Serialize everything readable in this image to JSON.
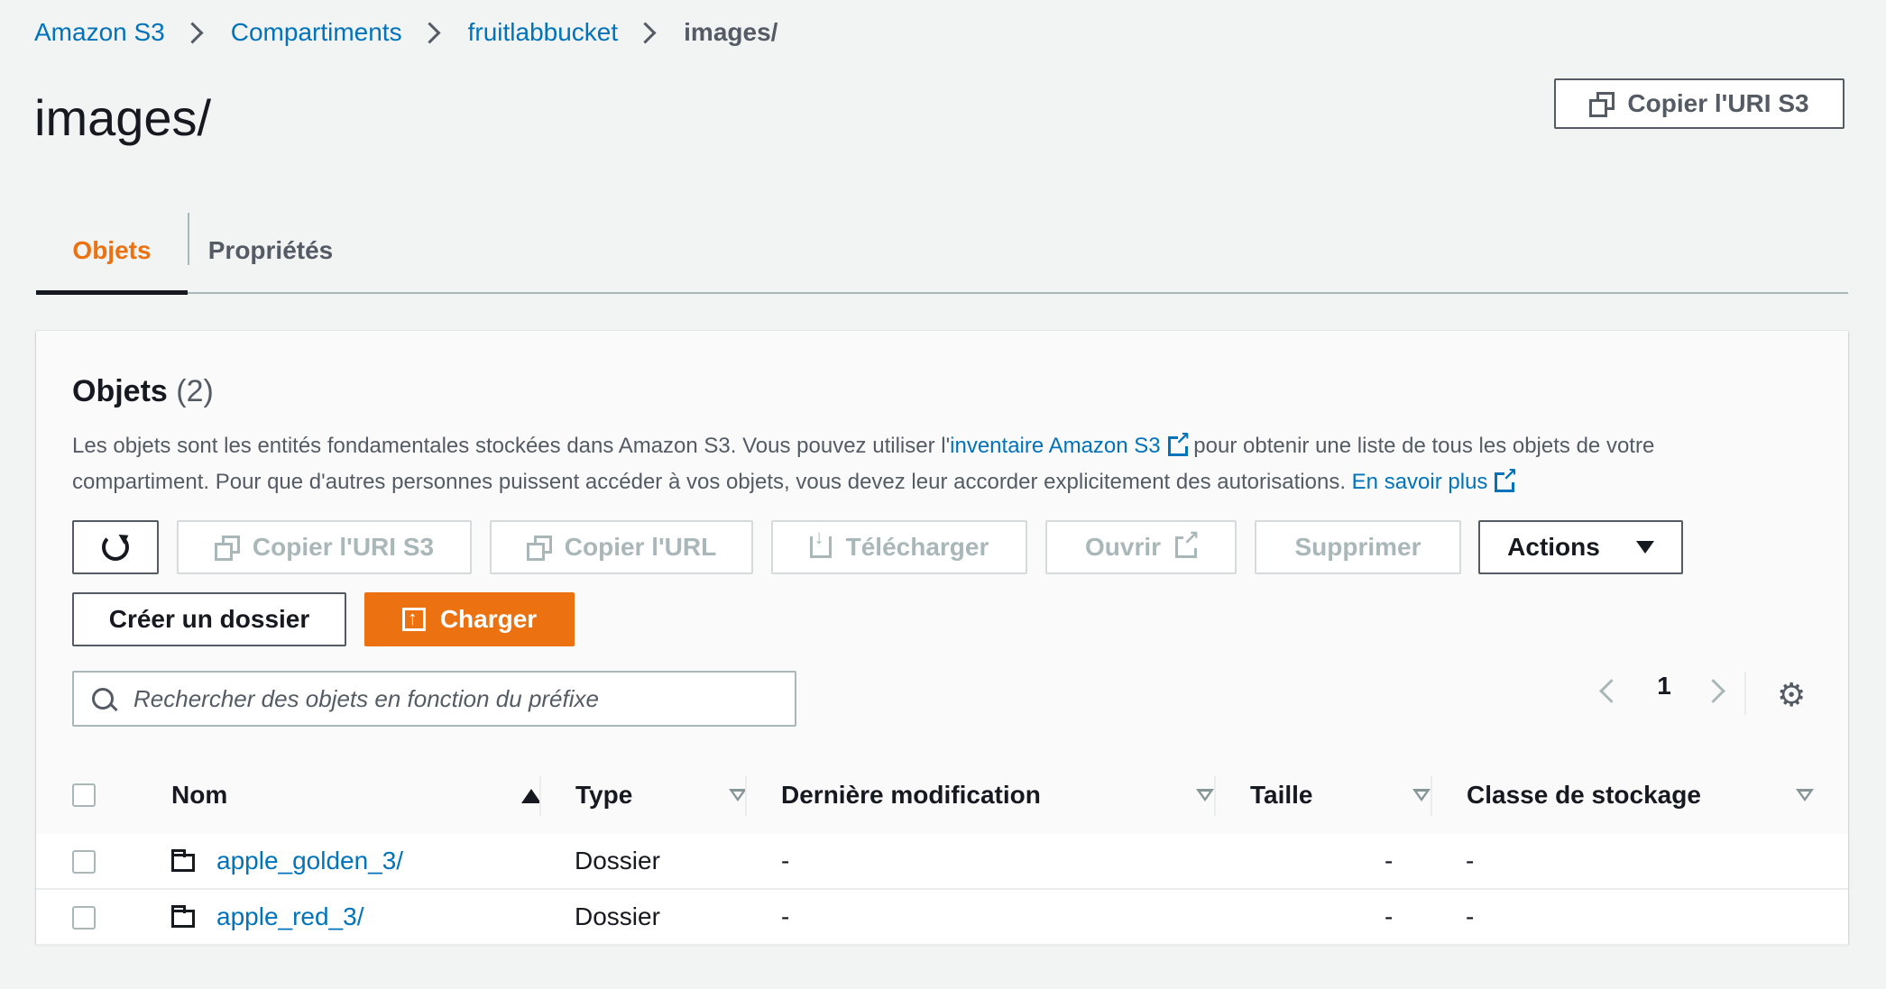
{
  "breadcrumb": {
    "items": [
      "Amazon S3",
      "Compartiments",
      "fruitlabbucket"
    ],
    "current": "images/"
  },
  "page": {
    "title": "images/",
    "copy_uri_button": "Copier l'URI S3"
  },
  "tabs": [
    {
      "label": "Objets",
      "active": true
    },
    {
      "label": "Propriétés",
      "active": false
    }
  ],
  "objects_panel": {
    "title": "Objets",
    "count": "(2)",
    "description_part1": "Les objets sont les entités fondamentales stockées dans Amazon S3. Vous pouvez utiliser l'",
    "inventory_link": "inventaire Amazon S3",
    "description_part2": " pour obtenir une liste de tous les objets de votre compartiment. Pour que d'autres personnes puissent accéder à vos objets, vous devez leur accorder explicitement des autorisations. ",
    "learn_more_link": "En savoir plus"
  },
  "toolbar": {
    "copy_uri": "Copier l'URI S3",
    "copy_url": "Copier l'URL",
    "download": "Télécharger",
    "open": "Ouvrir",
    "delete": "Supprimer",
    "actions": "Actions",
    "create_folder": "Créer un dossier",
    "upload": "Charger"
  },
  "search": {
    "placeholder": "Rechercher des objets en fonction du préfixe",
    "value": ""
  },
  "pagination": {
    "current_page": "1"
  },
  "table": {
    "columns": [
      "Nom",
      "Type",
      "Dernière modification",
      "Taille",
      "Classe de stockage"
    ],
    "rows": [
      {
        "name": "apple_golden_3/",
        "type": "Dossier",
        "modified": "-",
        "size": "-",
        "storage_class": "-"
      },
      {
        "name": "apple_red_3/",
        "type": "Dossier",
        "modified": "-",
        "size": "-",
        "storage_class": "-"
      }
    ]
  },
  "colors": {
    "link": "#0073bb",
    "accent_orange": "#ec7211",
    "text_dark": "#16191f",
    "text_secondary": "#545b64",
    "disabled": "#aab7b8"
  },
  "icons": [
    "chevron-right-icon",
    "copy-icon",
    "refresh-icon",
    "download-icon",
    "external-link-icon",
    "caret-down-icon",
    "upload-icon",
    "search-icon",
    "chevron-left-icon",
    "gear-icon",
    "sort-ascending-icon",
    "sort-icon",
    "folder-icon"
  ]
}
